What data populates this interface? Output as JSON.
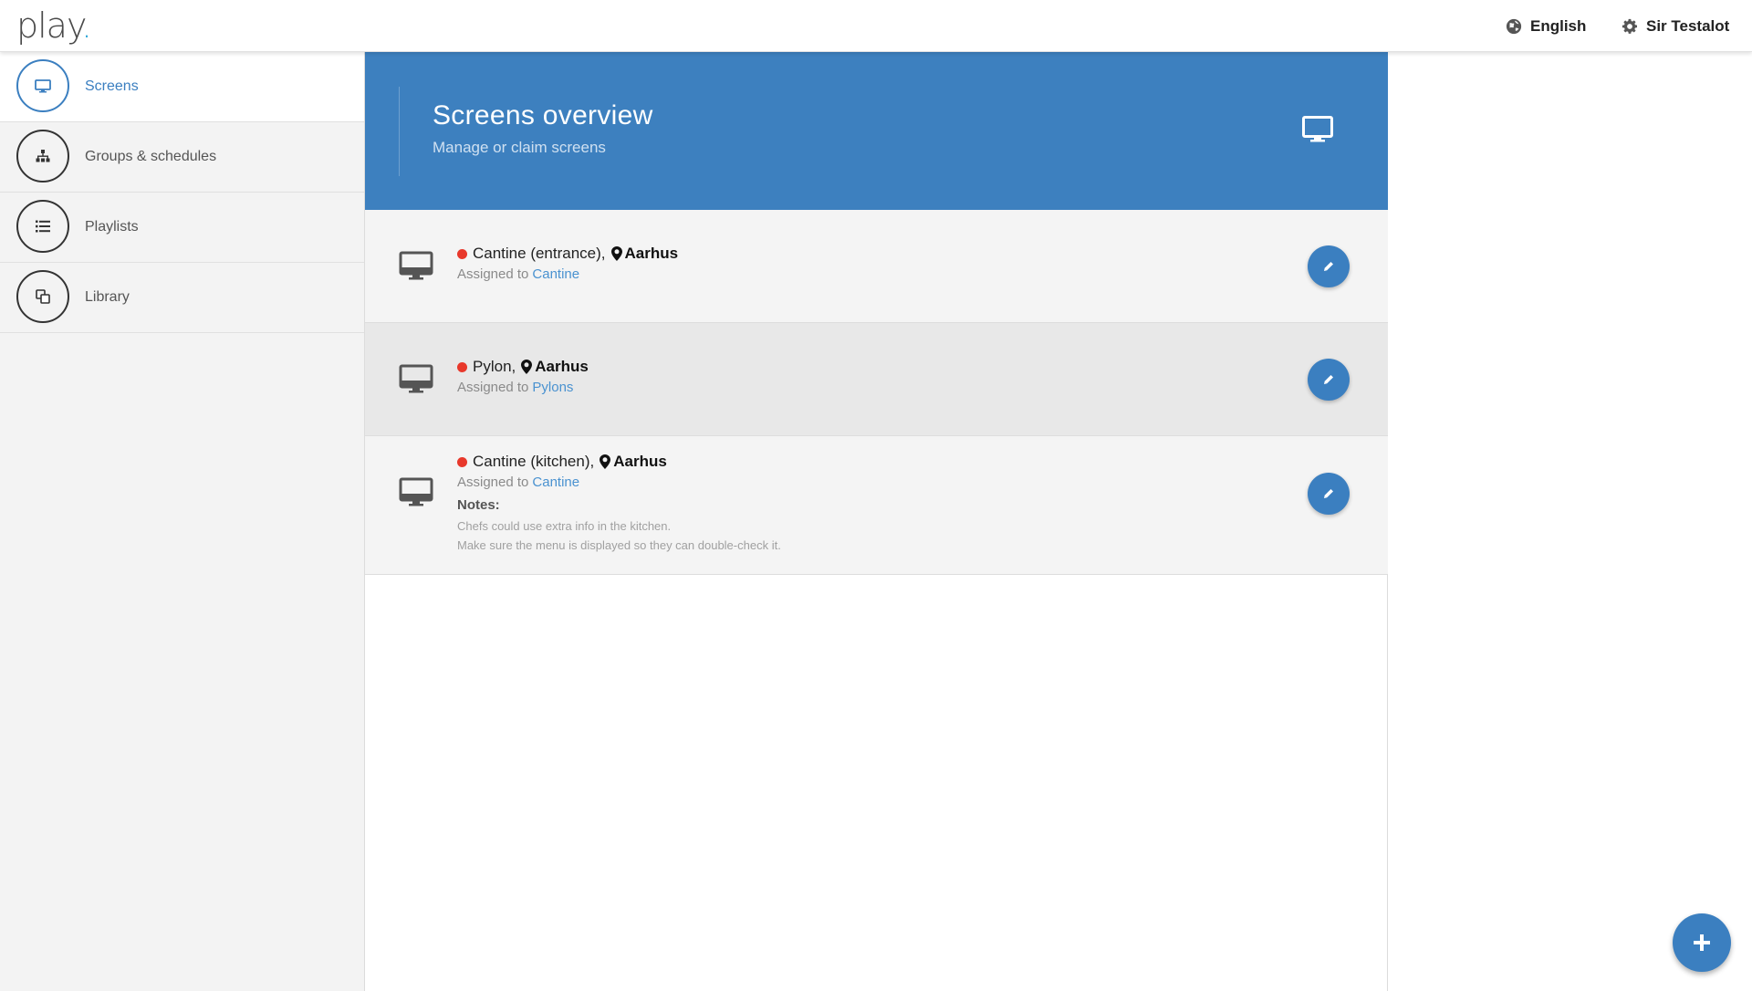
{
  "brand": {
    "logo_text": "play",
    "logo_dot": ".",
    "accent_color": "#2aa6d8"
  },
  "topbar": {
    "language": {
      "label": "English",
      "icon": "globe-icon"
    },
    "user": {
      "label": "Sir Testalot",
      "icon": "gear-icon"
    }
  },
  "sidebar": {
    "items": [
      {
        "label": "Screens",
        "icon": "monitor-icon",
        "active": true
      },
      {
        "label": "Groups & schedules",
        "icon": "sitemap-icon",
        "active": false
      },
      {
        "label": "Playlists",
        "icon": "list-icon",
        "active": false
      },
      {
        "label": "Library",
        "icon": "copy-icon",
        "active": false
      }
    ]
  },
  "header": {
    "title": "Screens overview",
    "subtitle": "Manage or claim screens",
    "icon": "monitor-icon",
    "color": "#3d80bf"
  },
  "screens": [
    {
      "name": "Cantine (entrance),",
      "location": "Aarhus",
      "status_color": "#e8382b",
      "assigned_prefix": "Assigned to",
      "assigned_group": "Cantine"
    },
    {
      "name": "Pylon,",
      "location": "Aarhus",
      "status_color": "#e8382b",
      "assigned_prefix": "Assigned to",
      "assigned_group": "Pylons"
    },
    {
      "name": "Cantine (kitchen),",
      "location": "Aarhus",
      "status_color": "#e8382b",
      "assigned_prefix": "Assigned to",
      "assigned_group": "Cantine",
      "notes_label": "Notes:",
      "notes": [
        "Chefs could use extra info in the kitchen.",
        "Make sure the menu is displayed so they can double-check it."
      ]
    }
  ],
  "fab": {
    "icon": "plus-icon"
  }
}
